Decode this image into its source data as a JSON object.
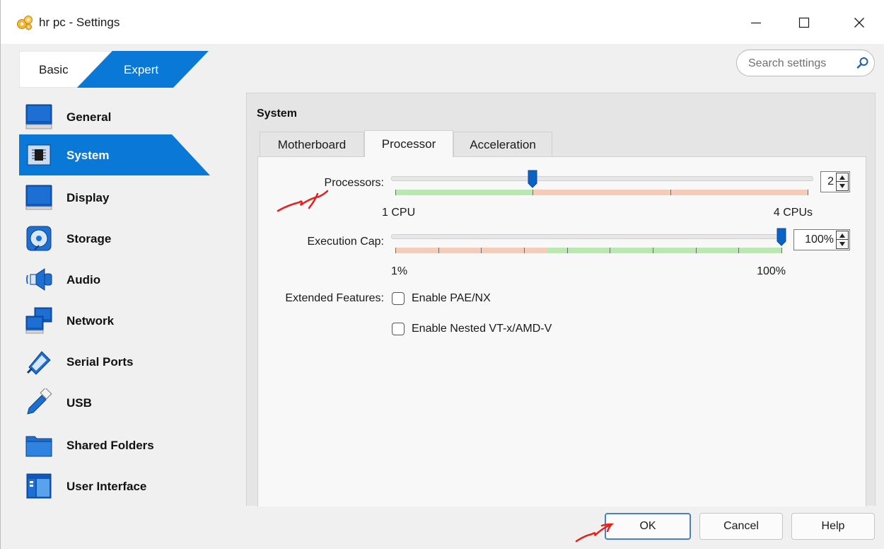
{
  "window": {
    "title": "hr pc - Settings",
    "icon": "gear-cluster-icon"
  },
  "mode": {
    "basic_label": "Basic",
    "expert_label": "Expert",
    "selected": "Expert"
  },
  "search": {
    "placeholder": "Search settings"
  },
  "sidebar": {
    "items": [
      {
        "label": "General",
        "icon": "general-screen-icon"
      },
      {
        "label": "System",
        "icon": "chip-icon",
        "selected": true
      },
      {
        "label": "Display",
        "icon": "monitor-icon"
      },
      {
        "label": "Storage",
        "icon": "disc-icon"
      },
      {
        "label": "Audio",
        "icon": "speaker-icon"
      },
      {
        "label": "Network",
        "icon": "network-icon"
      },
      {
        "label": "Serial Ports",
        "icon": "serial-port-icon"
      },
      {
        "label": "USB",
        "icon": "usb-icon"
      },
      {
        "label": "Shared Folders",
        "icon": "folder-icon"
      },
      {
        "label": "User Interface",
        "icon": "user-interface-icon"
      }
    ]
  },
  "panel": {
    "title": "System",
    "tabs": [
      {
        "label": "Motherboard"
      },
      {
        "label": "Processor",
        "selected": true
      },
      {
        "label": "Acceleration"
      }
    ],
    "processors": {
      "label": "Processors:",
      "value": "2",
      "min_label": "1 CPU",
      "max_label": "4 CPUs",
      "min": 1,
      "max": 4,
      "current": 2,
      "recommended_max": 2
    },
    "execution_cap": {
      "label": "Execution Cap:",
      "value": "100%",
      "min_label": "1%",
      "max_label": "100%",
      "min": 1,
      "max": 100,
      "current": 100,
      "warn_below": 40
    },
    "extended_features": {
      "label": "Extended Features:",
      "options": [
        {
          "label": "Enable PAE/NX",
          "checked": false
        },
        {
          "label": "Enable Nested VT-x/AMD-V",
          "checked": false
        }
      ]
    }
  },
  "buttons": {
    "ok": "OK",
    "cancel": "Cancel",
    "help": "Help"
  },
  "colors": {
    "accent": "#0a78d7",
    "scale_ok": "#b9e8b0",
    "scale_warn": "#f6cbb8",
    "annotation": "#e8201c"
  }
}
